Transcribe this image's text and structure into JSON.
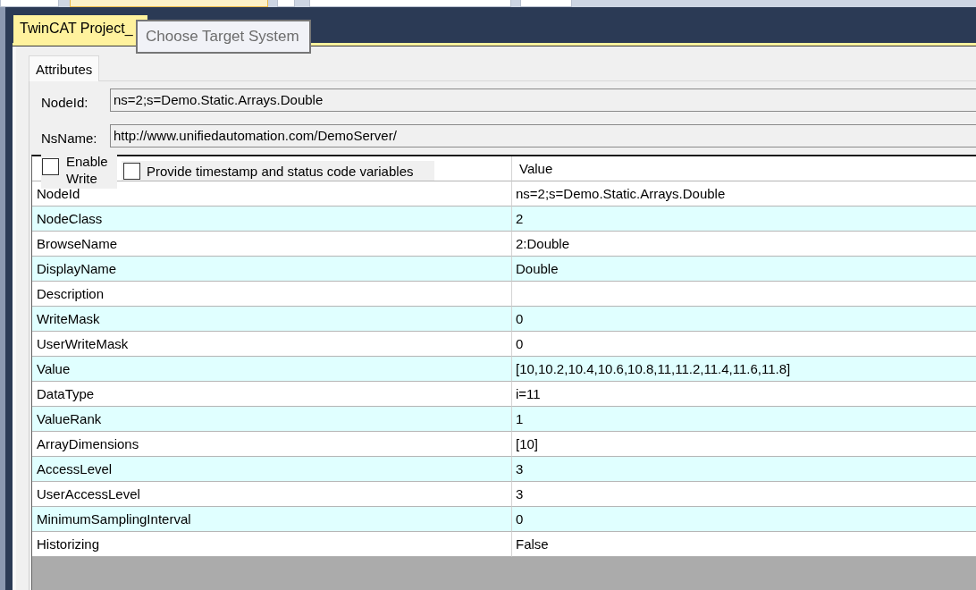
{
  "document_tab": {
    "label": "TwinCAT Project_",
    "selected": true
  },
  "tooltip": {
    "text": "Choose Target System"
  },
  "tabs": [
    {
      "label": "Attributes",
      "selected": true
    }
  ],
  "fields": [
    {
      "label": "NodeId:",
      "value": "ns=2;s=Demo.Static.Arrays.Double"
    },
    {
      "label": "NsName:",
      "value": "http://www.unifiedautomation.com/DemoServer/"
    }
  ],
  "options": [
    {
      "label": "Enable Write",
      "checked": false
    },
    {
      "label": "Provide timestamp and status code variables",
      "checked": false
    }
  ],
  "table": {
    "header": {
      "value": "Value"
    },
    "rows": [
      {
        "attribute": "NodeId",
        "value": "ns=2;s=Demo.Static.Arrays.Double"
      },
      {
        "attribute": "NodeClass",
        "value": "2"
      },
      {
        "attribute": "BrowseName",
        "value": "2:Double"
      },
      {
        "attribute": "DisplayName",
        "value": "Double"
      },
      {
        "attribute": "Description"
      },
      {
        "attribute": "WriteMask",
        "value": "0"
      },
      {
        "attribute": "UserWriteMask",
        "value": "0"
      },
      {
        "attribute": "Value",
        "value": "[10,10.2,10.4,10.6,10.8,11,11.2,11.4,11.6,11.8]"
      },
      {
        "attribute": "DataType",
        "value": "i=11"
      },
      {
        "attribute": "ValueRank",
        "value": "1"
      },
      {
        "attribute": "ArrayDimensions",
        "value": "[10]"
      },
      {
        "attribute": "AccessLevel",
        "value": "3"
      },
      {
        "attribute": "UserAccessLevel",
        "value": "3"
      },
      {
        "attribute": "MinimumSamplingInterval",
        "value": "0"
      },
      {
        "attribute": "Historizing",
        "value": "False"
      }
    ]
  }
}
